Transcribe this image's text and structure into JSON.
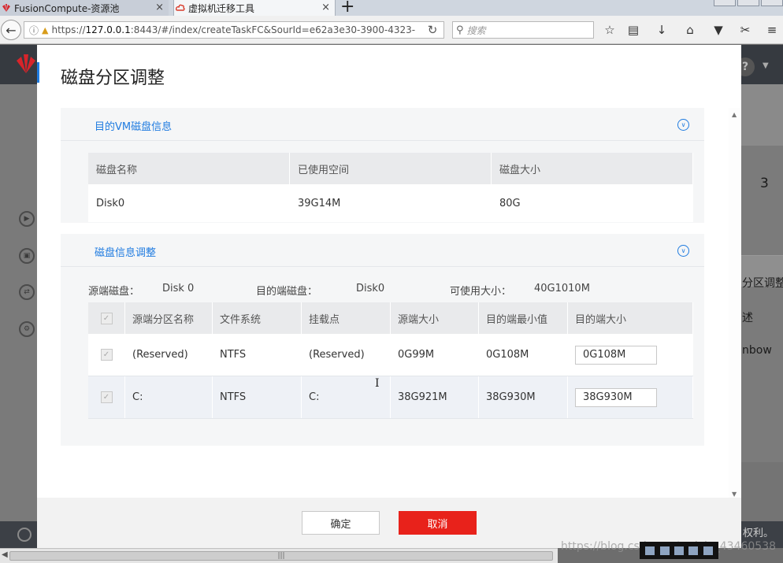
{
  "browser": {
    "tabs": [
      {
        "label": "FusionCompute-资源池",
        "close": "×"
      },
      {
        "label": "虚拟机迁移工具",
        "close": "×"
      }
    ],
    "new_tab": "+",
    "url_prefix": "https://",
    "url_host": "127.0.0.1",
    "url_rest": ":8443/#/index/createTaskFC&SourId=e62a3e30-3900-4323-",
    "search_placeholder": "搜索"
  },
  "background": {
    "help": "?",
    "right_texts": [
      "3",
      "分区调整",
      "述",
      "nbow"
    ],
    "footer_text": "权利。"
  },
  "modal": {
    "title": "磁盘分区调整",
    "target_vm_section": {
      "title": "目的VM磁盘信息",
      "columns": [
        "磁盘名称",
        "已使用空间",
        "磁盘大小"
      ],
      "rows": [
        [
          "Disk0",
          "39G14M",
          "80G"
        ]
      ]
    },
    "adjust_section": {
      "title": "磁盘信息调整",
      "source_disk_label": "源端磁盘：",
      "source_disk_value": "Disk 0",
      "target_disk_label": "目的端磁盘：",
      "target_disk_value": "Disk0",
      "available_label": "可使用大小：",
      "available_value": "40G1010M",
      "columns": [
        "源端分区名称",
        "文件系统",
        "挂载点",
        "源端大小",
        "目的端最小值",
        "目的端大小"
      ],
      "rows": [
        {
          "name": "(Reserved)",
          "fs": "NTFS",
          "mount": "(Reserved)",
          "src_size": "0G99M",
          "min": "0G108M",
          "target": "0G108M"
        },
        {
          "name": "C:",
          "fs": "NTFS",
          "mount": "C:",
          "src_size": "38G921M",
          "min": "38G930M",
          "target": "38G930M"
        }
      ]
    },
    "buttons": {
      "ok": "确定",
      "cancel": "取消"
    }
  },
  "watermark": "https://blog.csdn.net/weixin_43460538",
  "colors": {
    "accent": "#1f7be0",
    "danger": "#e8221b",
    "header_bg": "#363a40"
  }
}
